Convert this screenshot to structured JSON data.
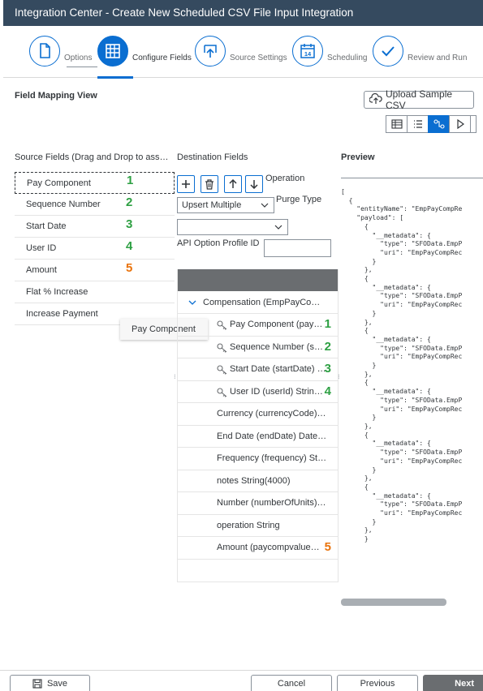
{
  "title": "Integration Center - Create New Scheduled CSV File Input Integration",
  "wizard": {
    "steps": [
      {
        "label": "Options",
        "icon": "document-icon",
        "active": false
      },
      {
        "label": "Configure Fields",
        "icon": "grid-icon",
        "active": true
      },
      {
        "label": "Source Settings",
        "icon": "upload-icon",
        "active": false
      },
      {
        "label": "Scheduling",
        "icon": "calendar-icon",
        "active": false,
        "day": "14"
      },
      {
        "label": "Review and Run",
        "icon": "checkmark-icon",
        "active": false
      }
    ]
  },
  "section_title": "Field Mapping View",
  "upload_button": {
    "label": "Upload Sample CSV",
    "icon": "cloud-upload-icon"
  },
  "view_toggles": [
    "table-view-icon",
    "list-view-icon",
    "mapping-view-icon",
    "play-icon"
  ],
  "source": {
    "header": "Source Fields (Drag and Drop to ass…",
    "fields": [
      {
        "label": "Pay Component",
        "num": "1",
        "color": "green"
      },
      {
        "label": "Sequence Number",
        "num": "2",
        "color": "green"
      },
      {
        "label": "Start Date",
        "num": "3",
        "color": "green"
      },
      {
        "label": "User ID",
        "num": "4",
        "color": "green"
      },
      {
        "label": "Amount",
        "num": "5",
        "color": "orange"
      },
      {
        "label": "Flat % Increase",
        "num": "",
        "color": ""
      },
      {
        "label": "Increase Payment",
        "num": "",
        "color": ""
      }
    ],
    "drag_ghost": "Pay Component"
  },
  "destination": {
    "header": "Destination Fields",
    "operation_label": "Operation",
    "purge_type_label": "Purge Type",
    "operation_value": "Upsert Multiple",
    "purge_value": "",
    "api_profile_label": "API Option Profile ID",
    "api_profile_value": "",
    "group": "Compensation (EmpPayCo…",
    "rows": [
      {
        "label": "Pay Component (pay…",
        "key": true,
        "num": "1",
        "color": "green"
      },
      {
        "label": "Sequence Number (se…",
        "key": true,
        "num": "2",
        "color": "green"
      },
      {
        "label": "Start Date (startDate) …",
        "key": true,
        "num": "3",
        "color": "green"
      },
      {
        "label": "User ID (userId) String…",
        "key": true,
        "num": "4",
        "color": "green"
      },
      {
        "label": "Currency (currencyCode)…",
        "key": false,
        "num": "",
        "color": ""
      },
      {
        "label": "End Date (endDate) Date…",
        "key": false,
        "num": "",
        "color": ""
      },
      {
        "label": "Frequency (frequency) St…",
        "key": false,
        "num": "",
        "color": ""
      },
      {
        "label": "notes String(4000)",
        "key": false,
        "num": "",
        "color": ""
      },
      {
        "label": "Number (numberOfUnits)…",
        "key": false,
        "num": "",
        "color": ""
      },
      {
        "label": "operation String",
        "key": false,
        "num": "",
        "color": ""
      },
      {
        "label": "Amount (paycompvalue) …",
        "key": false,
        "num": "5",
        "color": "orange"
      }
    ]
  },
  "preview": {
    "header": "Preview",
    "json_text": "[\n  {\n    \"entityName\": \"EmpPayCompRe\n    \"payload\": [\n      {\n        \"__metadata\": {\n          \"type\": \"SFOData.EmpP\n          \"uri\": \"EmpPayCompRec\n        }\n      },\n      {\n        \"__metadata\": {\n          \"type\": \"SFOData.EmpP\n          \"uri\": \"EmpPayCompRec\n        }\n      },\n      {\n        \"__metadata\": {\n          \"type\": \"SFOData.EmpP\n          \"uri\": \"EmpPayCompRec\n        }\n      },\n      {\n        \"__metadata\": {\n          \"type\": \"SFOData.EmpP\n          \"uri\": \"EmpPayCompRec\n        }\n      },\n      {\n        \"__metadata\": {\n          \"type\": \"SFOData.EmpP\n          \"uri\": \"EmpPayCompRec\n        }\n      },\n      {\n        \"__metadata\": {\n          \"type\": \"SFOData.EmpP\n          \"uri\": \"EmpPayCompRec\n        }\n      },\n      }"
  },
  "footer": {
    "save_label": "Save",
    "cancel_label": "Cancel",
    "previous_label": "Previous",
    "next_label": "Next"
  },
  "colors": {
    "green": "#2ea043",
    "orange": "#e9730c",
    "accent": "#0a6ed1",
    "titlebar": "#354a5f"
  }
}
